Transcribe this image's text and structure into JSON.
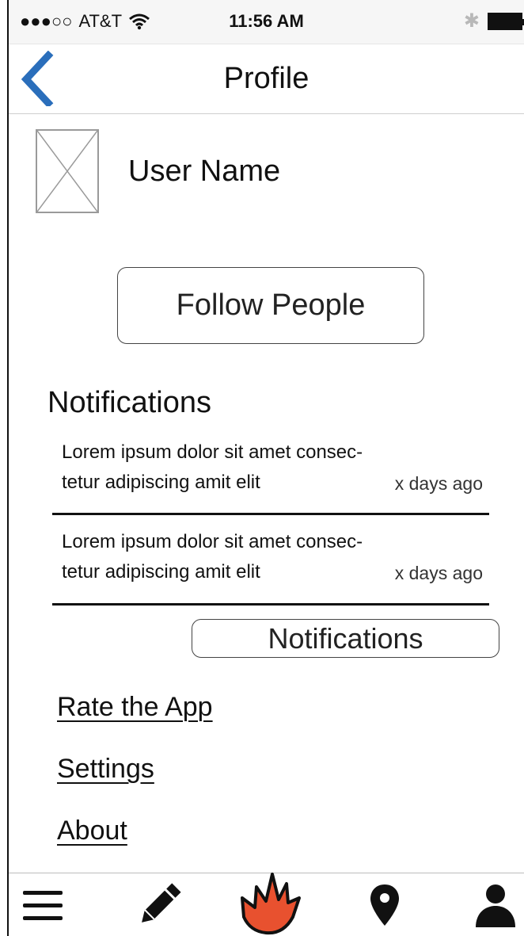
{
  "status_bar": {
    "signal": "●●●○○",
    "carrier": "AT&T",
    "time": "11:56 AM"
  },
  "nav": {
    "title": "Profile"
  },
  "profile": {
    "user_name": "User Name",
    "follow_label": "Follow People"
  },
  "notifications": {
    "heading": "Notifications",
    "items": [
      {
        "line1": "Lorem ipsum dolor sit amet consec-",
        "line2": "tetur adipiscing amit elit",
        "time": "x days ago"
      },
      {
        "line1": "Lorem ipsum dolor sit amet consec-",
        "line2": "tetur adipiscing amit elit",
        "time": "x days ago"
      }
    ],
    "button_label": "Notifications"
  },
  "menu": {
    "rate": "Rate the App",
    "settings": "Settings",
    "about": "About"
  },
  "tabbar": {
    "icons": [
      "menu-icon",
      "pencil-icon",
      "flame-icon",
      "location-pin-icon",
      "person-icon"
    ],
    "accent": "#e8512f"
  }
}
